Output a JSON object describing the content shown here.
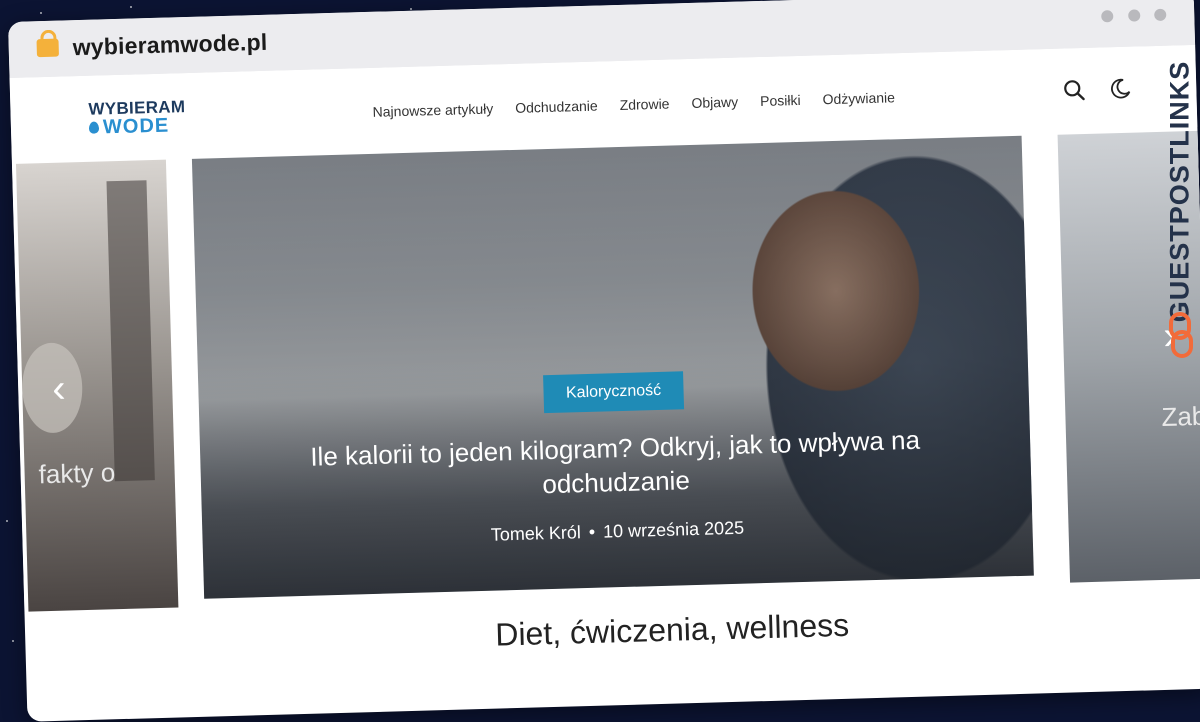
{
  "browser": {
    "url": "wybieramwode.pl"
  },
  "site": {
    "logo_line1": "WYBIERAM",
    "logo_line2": "WODE",
    "nav": [
      "Najnowsze artykuły",
      "Odchudzanie",
      "Zdrowie",
      "Objawy",
      "Posiłki",
      "Odżywianie"
    ]
  },
  "carousel": {
    "left_slide_text": "fakty o",
    "right_slide_text": "Zab",
    "main": {
      "category": "Kaloryczność",
      "title": "Ile kalorii to jeden kilogram? Odkryj, jak to wpływa na odchudzanie",
      "author": "Tomek Król",
      "separator": "•",
      "date": "10 września 2025"
    }
  },
  "below_heading": "Diet, ćwiczenia, wellness",
  "watermark": "GUESTPOSTLINKS",
  "colors": {
    "accent": "#1f8bb6",
    "brand_dark": "#1d3a5e",
    "brand_blue": "#2a8fd0",
    "watermark_orange": "#f26b3a"
  }
}
